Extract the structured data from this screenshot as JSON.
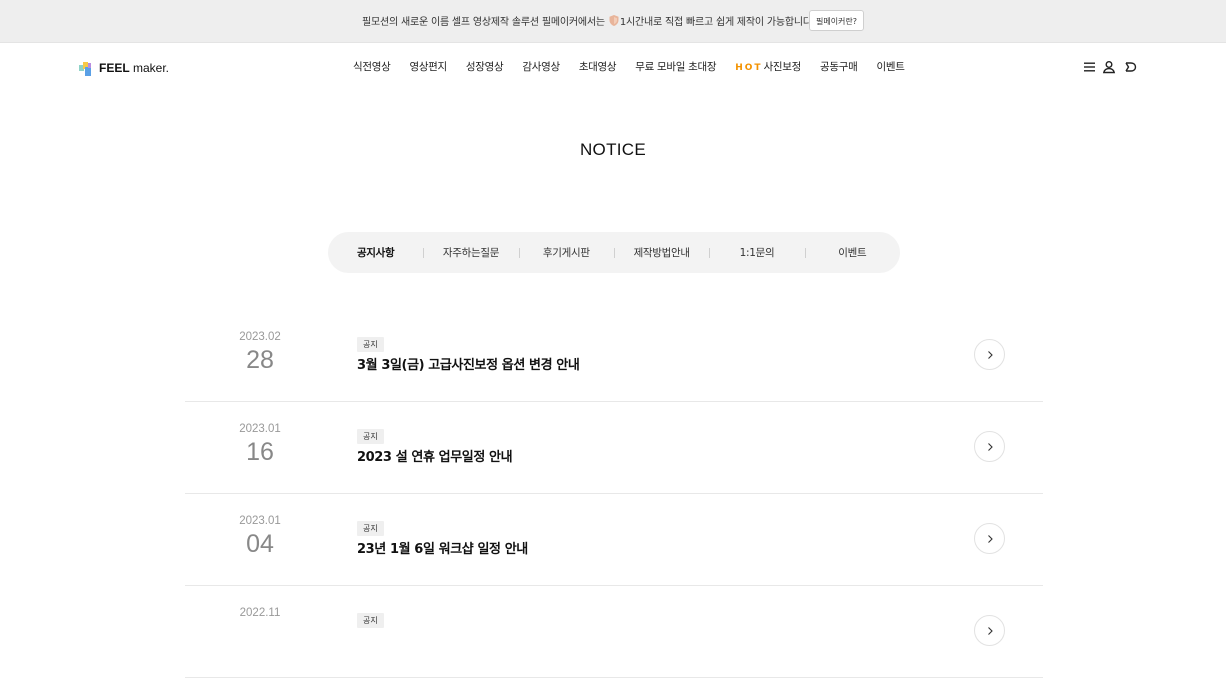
{
  "topbar": {
    "text_before": "필모션의 새로운 이름 셀프 영상제작 솔루션 필메이커에서는",
    "text_after": "1시간내로 직접 빠르고 쉽게 제작이 가능합니다.",
    "button_label": "필메이커란?"
  },
  "logo": {
    "bold": "FEEL",
    "light": " maker."
  },
  "nav": {
    "items": [
      "식전영상",
      "영상편지",
      "성장영상",
      "감사영상",
      "초대영상",
      "무료 모바일 초대장"
    ],
    "hot_badge": "HOT",
    "hot_item": "사진보정",
    "items_after": [
      "공동구매",
      "이벤트"
    ]
  },
  "utility_icons": [
    "menu-icon",
    "user-icon",
    "cart-icon"
  ],
  "page": {
    "title": "NOTICE"
  },
  "tabs": [
    "공지사항",
    "자주하는질문",
    "후기게시판",
    "제작방법안내",
    "1:1문의",
    "이벤트"
  ],
  "notices": [
    {
      "ym": "2023.02",
      "day": "28",
      "badge": "공지",
      "title": "3월 3일(금) 고급사진보정 옵션 변경 안내"
    },
    {
      "ym": "2023.01",
      "day": "16",
      "badge": "공지",
      "title": "2023 설 연휴 업무일정 안내"
    },
    {
      "ym": "2023.01",
      "day": "04",
      "badge": "공지",
      "title": "23년 1월 6일 워크샵 일정 안내"
    },
    {
      "ym": "2022.11",
      "day": "",
      "badge": "공지",
      "title": ""
    }
  ],
  "colors": {
    "accent": "#f39200",
    "topbar_bg": "#eeeeee",
    "tab_bg": "#f3f3f3"
  }
}
